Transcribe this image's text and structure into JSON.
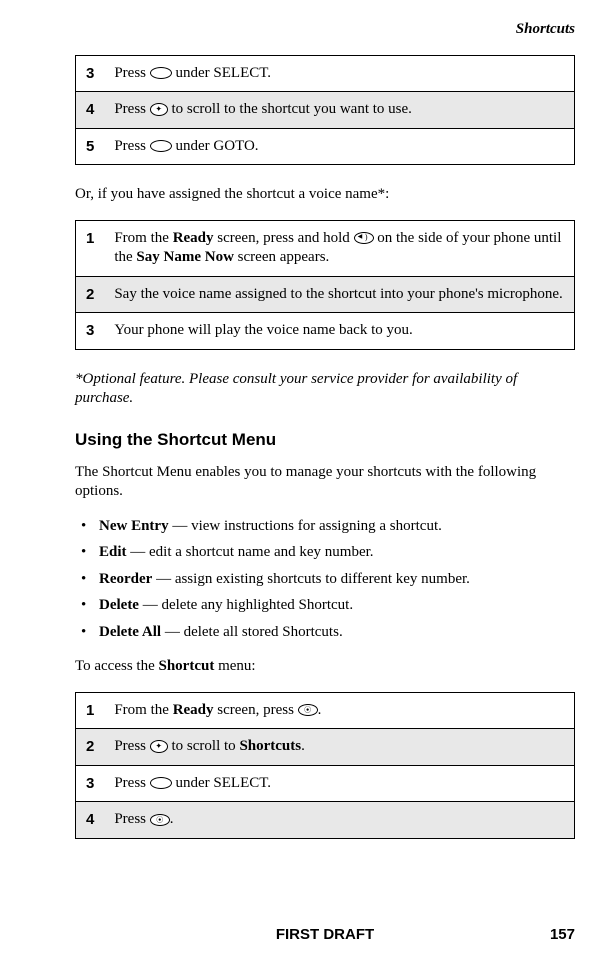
{
  "header": {
    "section": "Shortcuts"
  },
  "table1": {
    "rows": [
      {
        "num": "3",
        "before": "Press ",
        "after": " under SELECT.",
        "icon": "oval"
      },
      {
        "num": "4",
        "before": "Press ",
        "after": " to scroll to the shortcut you want to use.",
        "icon": "cross"
      },
      {
        "num": "5",
        "before": "Press ",
        "after": " under GOTO.",
        "icon": "oval"
      }
    ]
  },
  "intro2": "Or, if you have assigned the shortcut a voice name*:",
  "table2": {
    "rows": [
      {
        "num": "1",
        "parts": [
          "From the ",
          "Ready",
          " screen, press and hold ",
          " on the side of your phone until the ",
          "Say Name Now",
          " screen appears."
        ],
        "icon": "speaker"
      },
      {
        "num": "2",
        "text": "Say the voice name assigned to the shortcut into your phone's microphone."
      },
      {
        "num": "3",
        "text": "Your phone will play the voice name back to you."
      }
    ]
  },
  "footnote": "*Optional feature. Please consult your service provider for availability of purchase.",
  "subheading": "Using the Shortcut Menu",
  "menuintro": "The Shortcut Menu enables you to manage your shortcuts with the following options.",
  "bullets": [
    {
      "term": "New Entry",
      "desc": " — view instructions for assigning a shortcut."
    },
    {
      "term": "Edit",
      "desc": " — edit a shortcut name and key number."
    },
    {
      "term": "Reorder",
      "desc": " — assign existing shortcuts to different key number."
    },
    {
      "term": "Delete",
      "desc": " — delete any highlighted Shortcut."
    },
    {
      "term": "Delete All",
      "desc": " — delete all stored Shortcuts."
    }
  ],
  "access": {
    "before": "To access the ",
    "bold": "Shortcut",
    "after": " menu:"
  },
  "table3": {
    "rows": [
      {
        "num": "1",
        "parts": [
          "From the ",
          "Ready",
          " screen, press ",
          "."
        ],
        "icon": "m"
      },
      {
        "num": "2",
        "parts": [
          "Press ",
          " to scroll to ",
          "Shortcuts",
          "."
        ],
        "icon": "cross"
      },
      {
        "num": "3",
        "before": "Press ",
        "after": " under SELECT.",
        "icon": "oval"
      },
      {
        "num": "4",
        "before": "Press ",
        "after": ".",
        "icon": "m"
      }
    ]
  },
  "footer": {
    "center": "FIRST DRAFT",
    "page": "157"
  }
}
